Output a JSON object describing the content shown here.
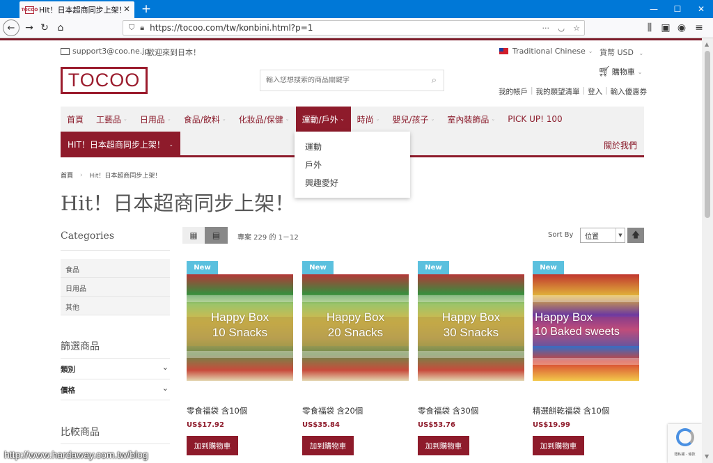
{
  "browser": {
    "tab_title": "Hit！日本超商同步上架！",
    "favicon_text": "TOCOO",
    "url": "https://tocoo.com/tw/konbini.html?p=1"
  },
  "topbar": {
    "email": "support3@coo.ne.jp",
    "welcome": "歡迎來到日本！",
    "language": "Traditional Chinese",
    "currency": "貨幣 USD"
  },
  "header": {
    "logo": "TOCOO",
    "search_placeholder": "輸入您想搜索的商品關鍵字",
    "cart": "購物車",
    "account_links": [
      "我的帳戶",
      "我的願望清單",
      "登入",
      "輸入優惠券"
    ]
  },
  "nav": {
    "items": [
      {
        "label": "首頁",
        "chev": false
      },
      {
        "label": "工藝品",
        "chev": true
      },
      {
        "label": "日用品",
        "chev": true
      },
      {
        "label": "食品/飲料",
        "chev": true
      },
      {
        "label": "化妝品/保健",
        "chev": true
      },
      {
        "label": "運動/戶外",
        "chev": true,
        "active": true
      },
      {
        "label": "時尚",
        "chev": true
      },
      {
        "label": "嬰兒/孩子",
        "chev": true
      },
      {
        "label": "室內裝飾品",
        "chev": true
      },
      {
        "label": "PICK UP! 100",
        "chev": false
      }
    ],
    "hit_button": "HIT！日本超商同步上架！",
    "about": "關於我們",
    "dropdown": [
      "運動",
      "戶外",
      "興趣愛好"
    ]
  },
  "breadcrumb": {
    "home": "首頁",
    "current": "Hit！日本超商同步上架！"
  },
  "page_title": "Hit！日本超商同步上架！",
  "sidebar": {
    "categories_title": "Categories",
    "categories": [
      "食品",
      "日用品",
      "其他"
    ],
    "filter_title": "篩選商品",
    "filters": [
      "類別",
      "價格"
    ],
    "compare_title": "比較商品"
  },
  "toolbar": {
    "count": "專案 229 的 1－12",
    "sort_label": "Sort By",
    "sort_value": "位置"
  },
  "products": [
    {
      "badge": "New",
      "line1": "Happy Box",
      "line2": "10 Snacks",
      "name": "零食福袋 含10個",
      "price": "US$17.92",
      "button": "加到購物車"
    },
    {
      "badge": "New",
      "line1": "Happy Box",
      "line2": "20 Snacks",
      "name": "零食福袋 含20個",
      "price": "US$35.84",
      "button": "加到購物車"
    },
    {
      "badge": "New",
      "line1": "Happy Box",
      "line2": "30 Snacks",
      "name": "零食福袋 含30個",
      "price": "US$53.76",
      "button": "加到購物車"
    },
    {
      "badge": "New",
      "line1": "Happy Box",
      "line2": "10 Baked sweets",
      "name": "精選餅乾福袋 含10個",
      "price": "US$19.99",
      "button": "加到購物車"
    }
  ],
  "recaptcha": "隱私權 - 條款",
  "watermark": "http://www.hardaway.com.tw/blog",
  "colors": {
    "brand": "#8e1b2b",
    "badge": "#5bc0de",
    "titlebar": "#0078d7"
  }
}
